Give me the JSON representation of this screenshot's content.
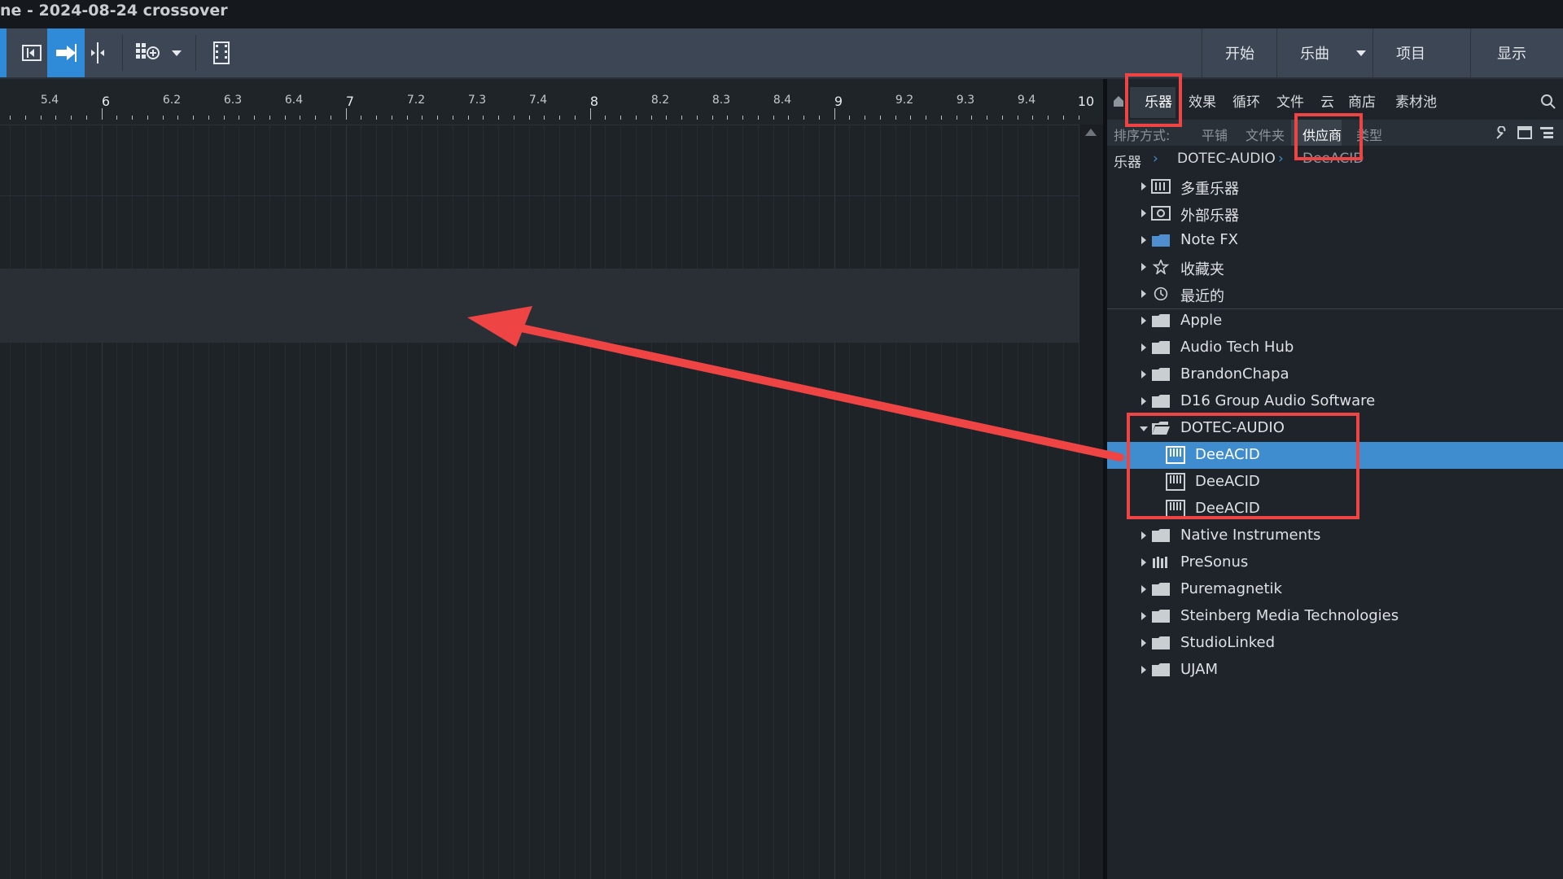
{
  "window": {
    "title": "ne - 2024-08-24 crossover"
  },
  "toolbar": {
    "right_buttons": [
      {
        "label": "开始"
      },
      {
        "label": "乐曲"
      },
      {
        "label": "项目"
      },
      {
        "label": "显示"
      }
    ]
  },
  "ruler": {
    "ticks": [
      "5.4",
      "6",
      "6.2",
      "6.3",
      "6.4",
      "7",
      "7.2",
      "7.3",
      "7.4",
      "8",
      "8.2",
      "8.3",
      "8.4",
      "9",
      "9.2",
      "9.3",
      "9.4",
      "10"
    ]
  },
  "browser": {
    "tabs": [
      "乐器",
      "效果",
      "循环",
      "文件",
      "云",
      "商店",
      "素材池"
    ],
    "selected_tab": "乐器",
    "sort_label": "排序方式:",
    "sort_options": [
      "平铺",
      "文件夹",
      "供应商",
      "类型"
    ],
    "selected_sort": "供应商",
    "breadcrumb": [
      "乐器",
      "DOTEC-AUDIO",
      "DeeACID"
    ],
    "special_items": [
      {
        "label": "多重乐器",
        "icon": "multi-instrument-icon"
      },
      {
        "label": "外部乐器",
        "icon": "external-instrument-icon"
      },
      {
        "label": "Note FX",
        "icon": "folder-icon"
      },
      {
        "label": "收藏夹",
        "icon": "star-icon"
      },
      {
        "label": "最近的",
        "icon": "clock-icon"
      }
    ],
    "vendors_before": [
      "Apple",
      "Audio Tech Hub",
      "BrandonChapa",
      "D16 Group Audio Software"
    ],
    "expanded_vendor": "DOTEC-AUDIO",
    "expanded_children": [
      "DeeACID",
      "DeeACID",
      "DeeACID"
    ],
    "vendors_after": [
      {
        "label": "Native Instruments",
        "icon": "folder-icon"
      },
      {
        "label": "PreSonus",
        "icon": "presonus-icon"
      },
      {
        "label": "Puremagnetik",
        "icon": "folder-icon"
      },
      {
        "label": "Steinberg Media Technologies",
        "icon": "folder-icon"
      },
      {
        "label": "StudioLinked",
        "icon": "folder-icon"
      },
      {
        "label": "UJAM",
        "icon": "folder-icon"
      }
    ]
  },
  "colors": {
    "accent": "#2f8ad8",
    "selection": "#3f8dcf",
    "annotation_red": "#ef4444"
  }
}
